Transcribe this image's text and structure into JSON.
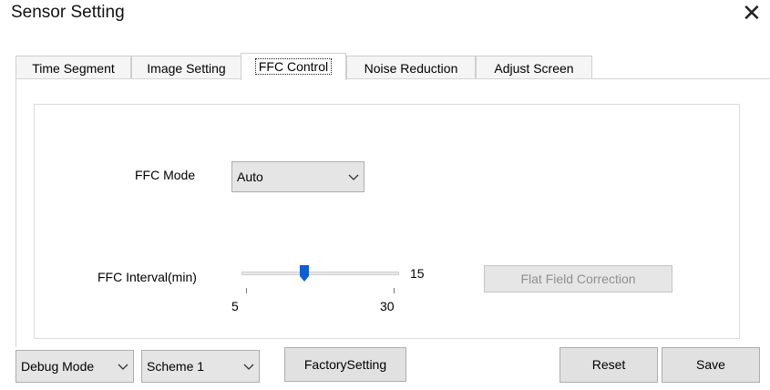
{
  "window": {
    "title": "Sensor Setting"
  },
  "tabs": [
    {
      "label": "Time Segment",
      "active": false
    },
    {
      "label": "Image Setting",
      "active": false
    },
    {
      "label": "FFC Control",
      "active": true
    },
    {
      "label": "Noise Reduction",
      "active": false
    },
    {
      "label": "Adjust Screen",
      "active": false
    }
  ],
  "ffc": {
    "mode_label": "FFC Mode",
    "mode_value": "Auto",
    "interval_label": "FFC Interval(min)",
    "interval_value": "15",
    "interval_min": "5",
    "interval_max": "30",
    "flat_field_button": "Flat Field Correction"
  },
  "footer": {
    "debug_mode": "Debug Mode",
    "scheme": "Scheme 1",
    "factory_setting": "FactorySetting",
    "reset": "Reset",
    "save": "Save"
  },
  "colors": {
    "slider_thumb": "#0a5fd6",
    "disabled_text": "#8f8f8f"
  },
  "icons": {
    "close": "close-icon",
    "dropdown": "chevron-down-icon"
  }
}
